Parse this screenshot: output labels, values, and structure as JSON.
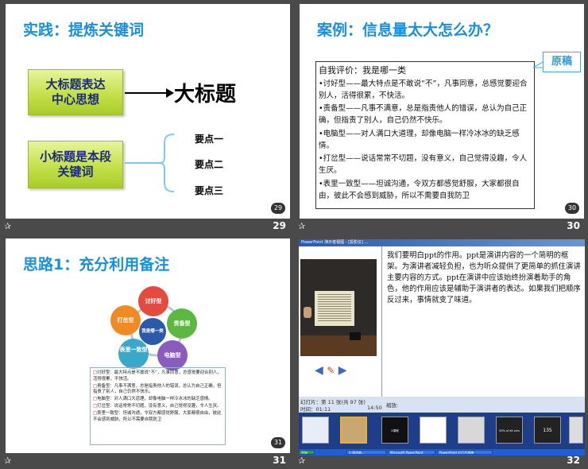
{
  "slides": [
    {
      "title": "实践：提炼关键词",
      "box1": [
        "大标题表达",
        "中心思想"
      ],
      "big_title": "大标题",
      "box2": [
        "小标题是本段",
        "关键词"
      ],
      "points": [
        "要点一",
        "要点二",
        "要点三"
      ],
      "badge": "29",
      "footer_num": "29",
      "footer_star": "✰"
    },
    {
      "title": "案例：信息量太大怎么办？",
      "review_heading": "自我评价：我是哪一类",
      "review_items": [
        "•讨好型——最大特点是不敢说“不”，凡事同意，总感觉要迎合别人，活得很累，不快活。",
        "•责备型——凡事不满意，总是指责他人的错误，总认为自己正确，但指责了别人，自己仍然不快乐。",
        "•电脑型——对人满口大道理，却像电脑一样冷冰冰的缺乏感情。",
        "•打岔型——说话常常不切题，没有意义，自己觉得没趣，令人生厌。",
        "•表里一致型——坦诚沟通，令双方都感觉舒服，大家都很自由，彼此不会感到威胁，所以不需要自我防卫"
      ],
      "yuangao": "原稿",
      "badge": "30",
      "footer_num": "30",
      "footer_star": "✰"
    },
    {
      "title": "思路1：充分利用备注",
      "nodes": [
        "讨好型",
        "责备型",
        "电脑型",
        "表里一致型",
        "打岔型"
      ],
      "center": "我是哪一类",
      "notes": [
        "讨好型：最大特点是不敢说“不”，凡事同意，总感觉要迎合别人，活得很累，不快活。",
        "责备型：凡事不满意，总是指责他人的错误，总认为自己正确，但指责了别人，自己仍然不快乐。",
        "电脑型：对人满口大道理，却像电脑一样冷冰冰的缺乏感情。",
        "打岔型：说话常常不切题，没有意义，自己觉得没趣，令人生厌。",
        "表里一致型：坦诚沟通，令双方都感觉舒服，大家都很自由，彼此不会感到威胁，所以不需要自我防卫"
      ],
      "badge": "31",
      "footer_num": "31",
      "footer_star": "✰"
    },
    {
      "window_title": "PowerPoint 演示者视图 - [投影仪] ...",
      "notes_text": "我们要明白ppt的作用。ppt是演讲内容的一个简明的框架。为演讲者减轻负担，也为听众提供了更简单的抓住演讲主要内容的方式。ppt在演讲中应该始终扮演着助手的角色，他的作用应该是辅助于演讲者的表达。如果我们把顺序反过来，事情就变了味道。",
      "slide_counter": "幻灯片：第 11 张(共 97 张)",
      "elapsed": "时间：01:11",
      "clock": "14:50",
      "zoom_label": "缩放:",
      "thumb_labels": [
        "X课程",
        "",
        "30% of all cars",
        "135"
      ],
      "taskbar_items": [
        "开始",
        "1-演讲者...",
        "Microsoft PowerPoint",
        "PowerPoint 幻灯片放映"
      ],
      "footer_num": "32",
      "footer_star": "✰"
    }
  ]
}
